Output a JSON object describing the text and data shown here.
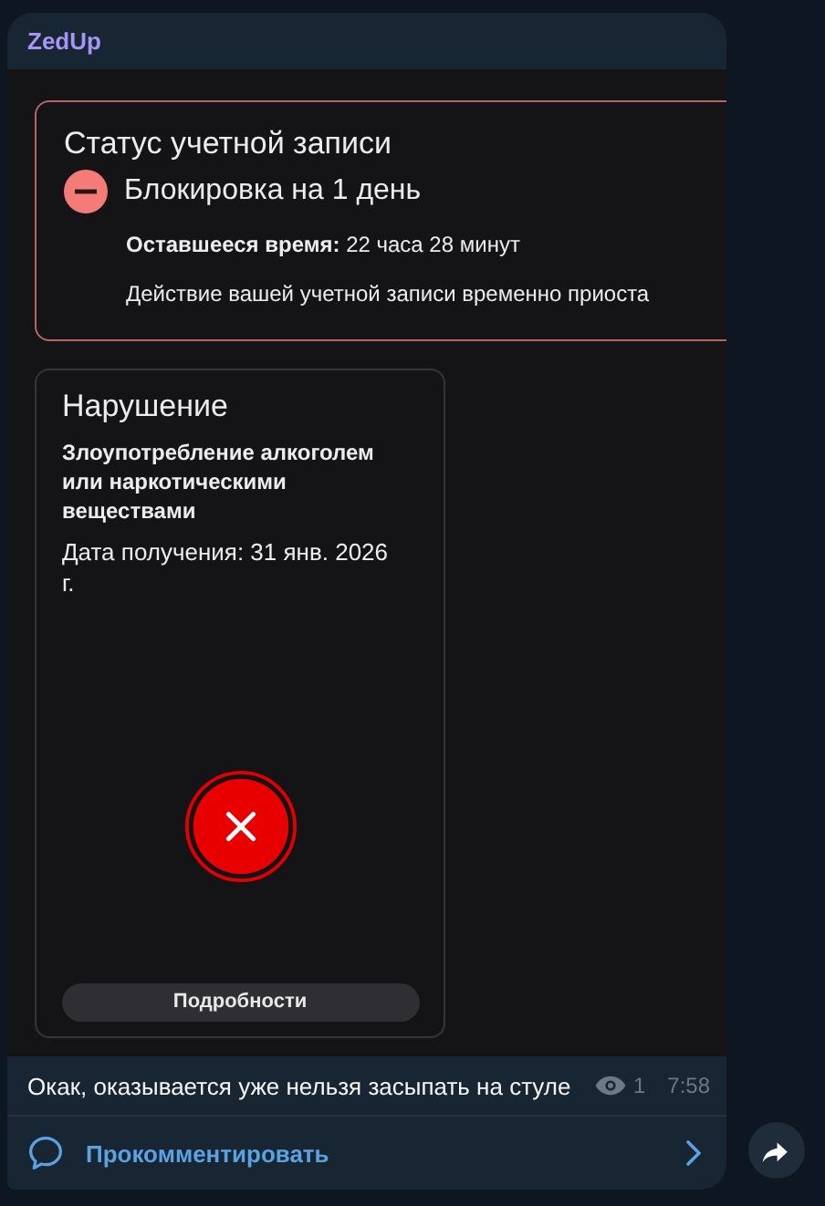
{
  "channel": {
    "name": "ZedUp"
  },
  "image": {
    "status_card": {
      "title": "Статус учетной записи",
      "block": "Блокировка на 1 день",
      "remaining": "**Оставшееся время:** 22 часа 28 минут",
      "description": "Действие вашей учетной записи временно приоста"
    },
    "violation_card": {
      "title": "Нарушение",
      "reason": "Злоупотребление алкоголем или наркотическими веществами",
      "date": "Дата получения: 31 янв. 2026 г.",
      "button": "Подробности"
    }
  },
  "message": {
    "text": "Окак, оказывается уже нельзя засыпать на стуле",
    "views": "1",
    "time": "7:58"
  },
  "comments": {
    "label": "Прокомментировать"
  }
}
